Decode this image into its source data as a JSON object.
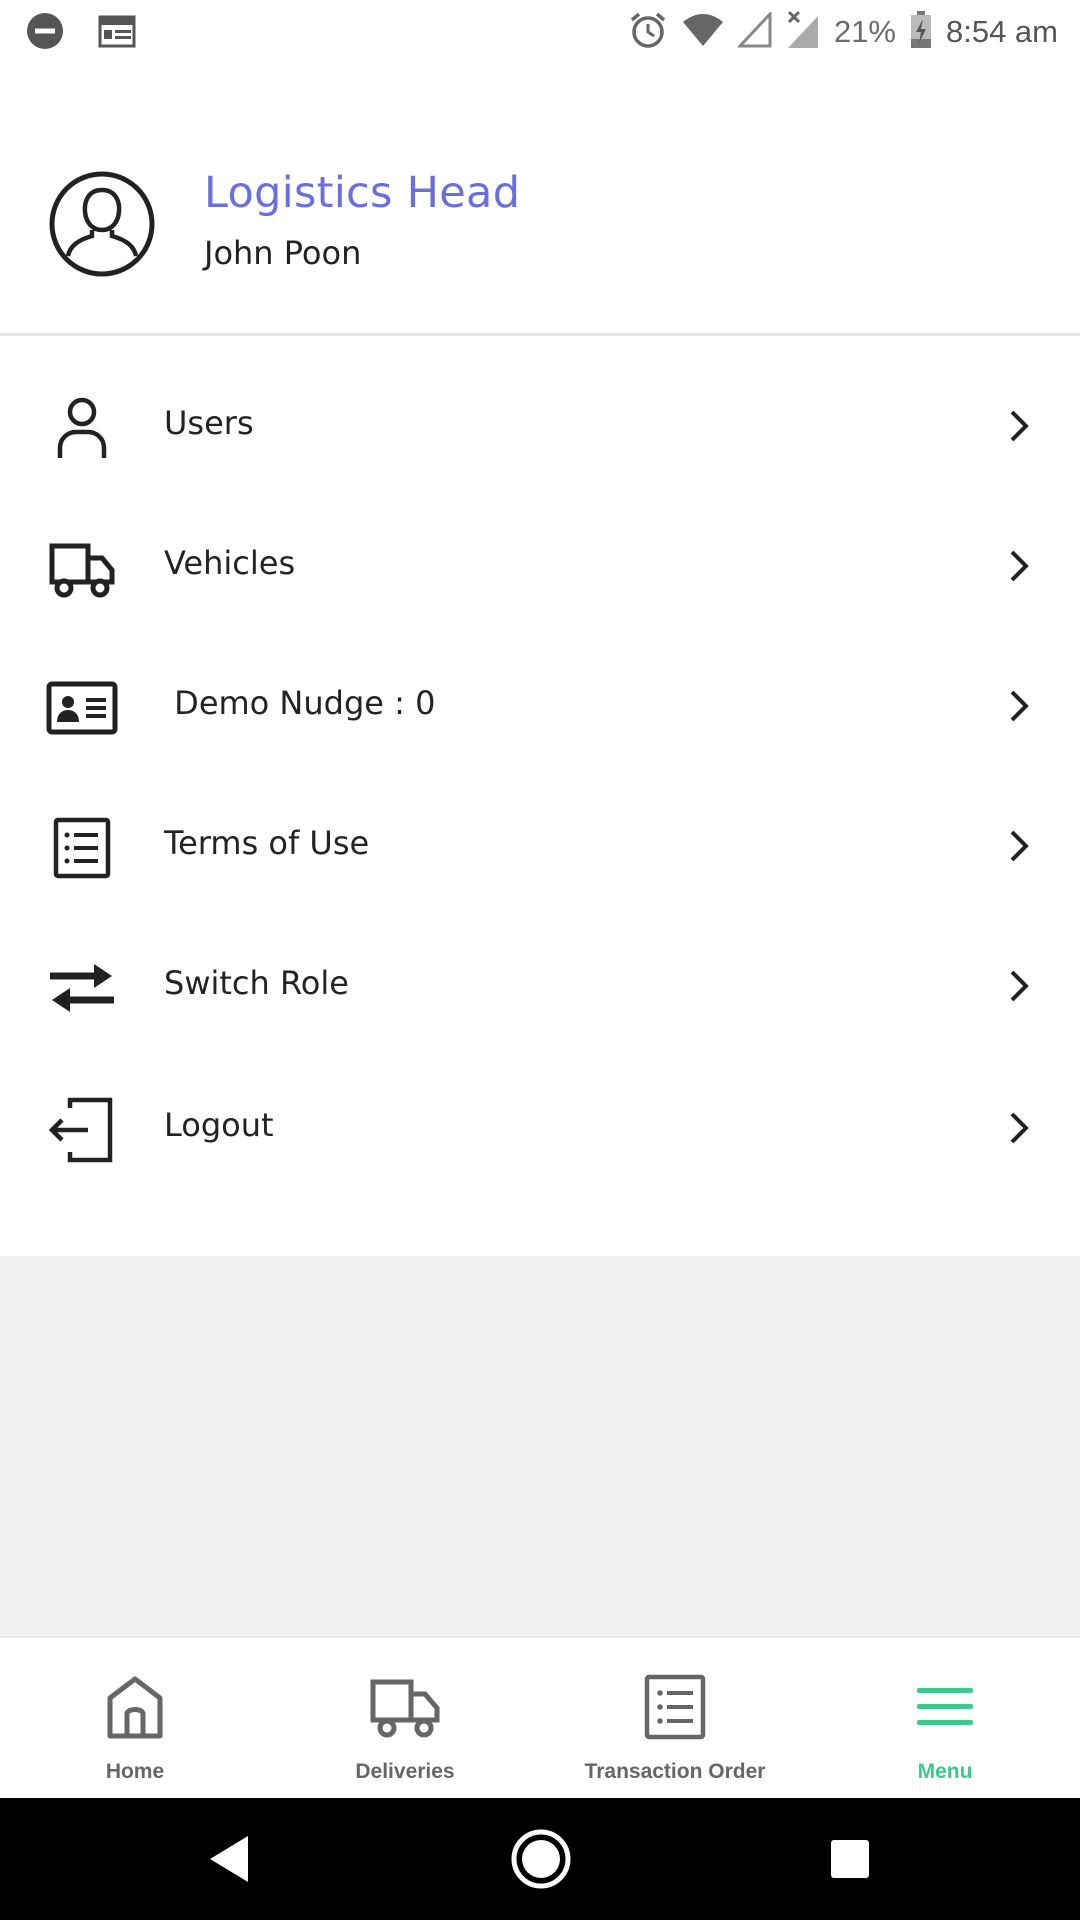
{
  "status_bar": {
    "battery_percent": "21%",
    "time": "8:54 am",
    "icons": [
      "dnd-icon",
      "calendar-icon",
      "alarm-icon",
      "wifi-icon",
      "signal-icon",
      "no-signal-icon",
      "battery-charging-icon"
    ]
  },
  "profile": {
    "role": "Logistics Head",
    "name": "John Poon",
    "avatar_icon": "user-avatar-icon",
    "role_color": "#6a6fe0"
  },
  "menu": {
    "items": [
      {
        "label": "Users",
        "icon": "user-icon"
      },
      {
        "label": "Vehicles",
        "icon": "truck-icon"
      },
      {
        "label": " Demo Nudge : 0",
        "icon": "id-card-icon"
      },
      {
        "label": "Terms of Use",
        "icon": "list-document-icon"
      },
      {
        "label": "Switch Role",
        "icon": "swap-arrows-icon"
      },
      {
        "label": "Logout",
        "icon": "logout-icon"
      }
    ]
  },
  "bottom_nav": {
    "active_color": "#3cc98c",
    "items": [
      {
        "label": "Home",
        "icon": "home-icon",
        "active": false
      },
      {
        "label": "Deliveries",
        "icon": "truck-icon",
        "active": false
      },
      {
        "label": "Transaction Order",
        "icon": "list-document-icon",
        "active": false
      },
      {
        "label": "Menu",
        "icon": "hamburger-menu-icon",
        "active": true
      }
    ]
  },
  "system_nav": {
    "buttons": [
      "back-icon",
      "home-circle-icon",
      "recents-icon"
    ]
  }
}
